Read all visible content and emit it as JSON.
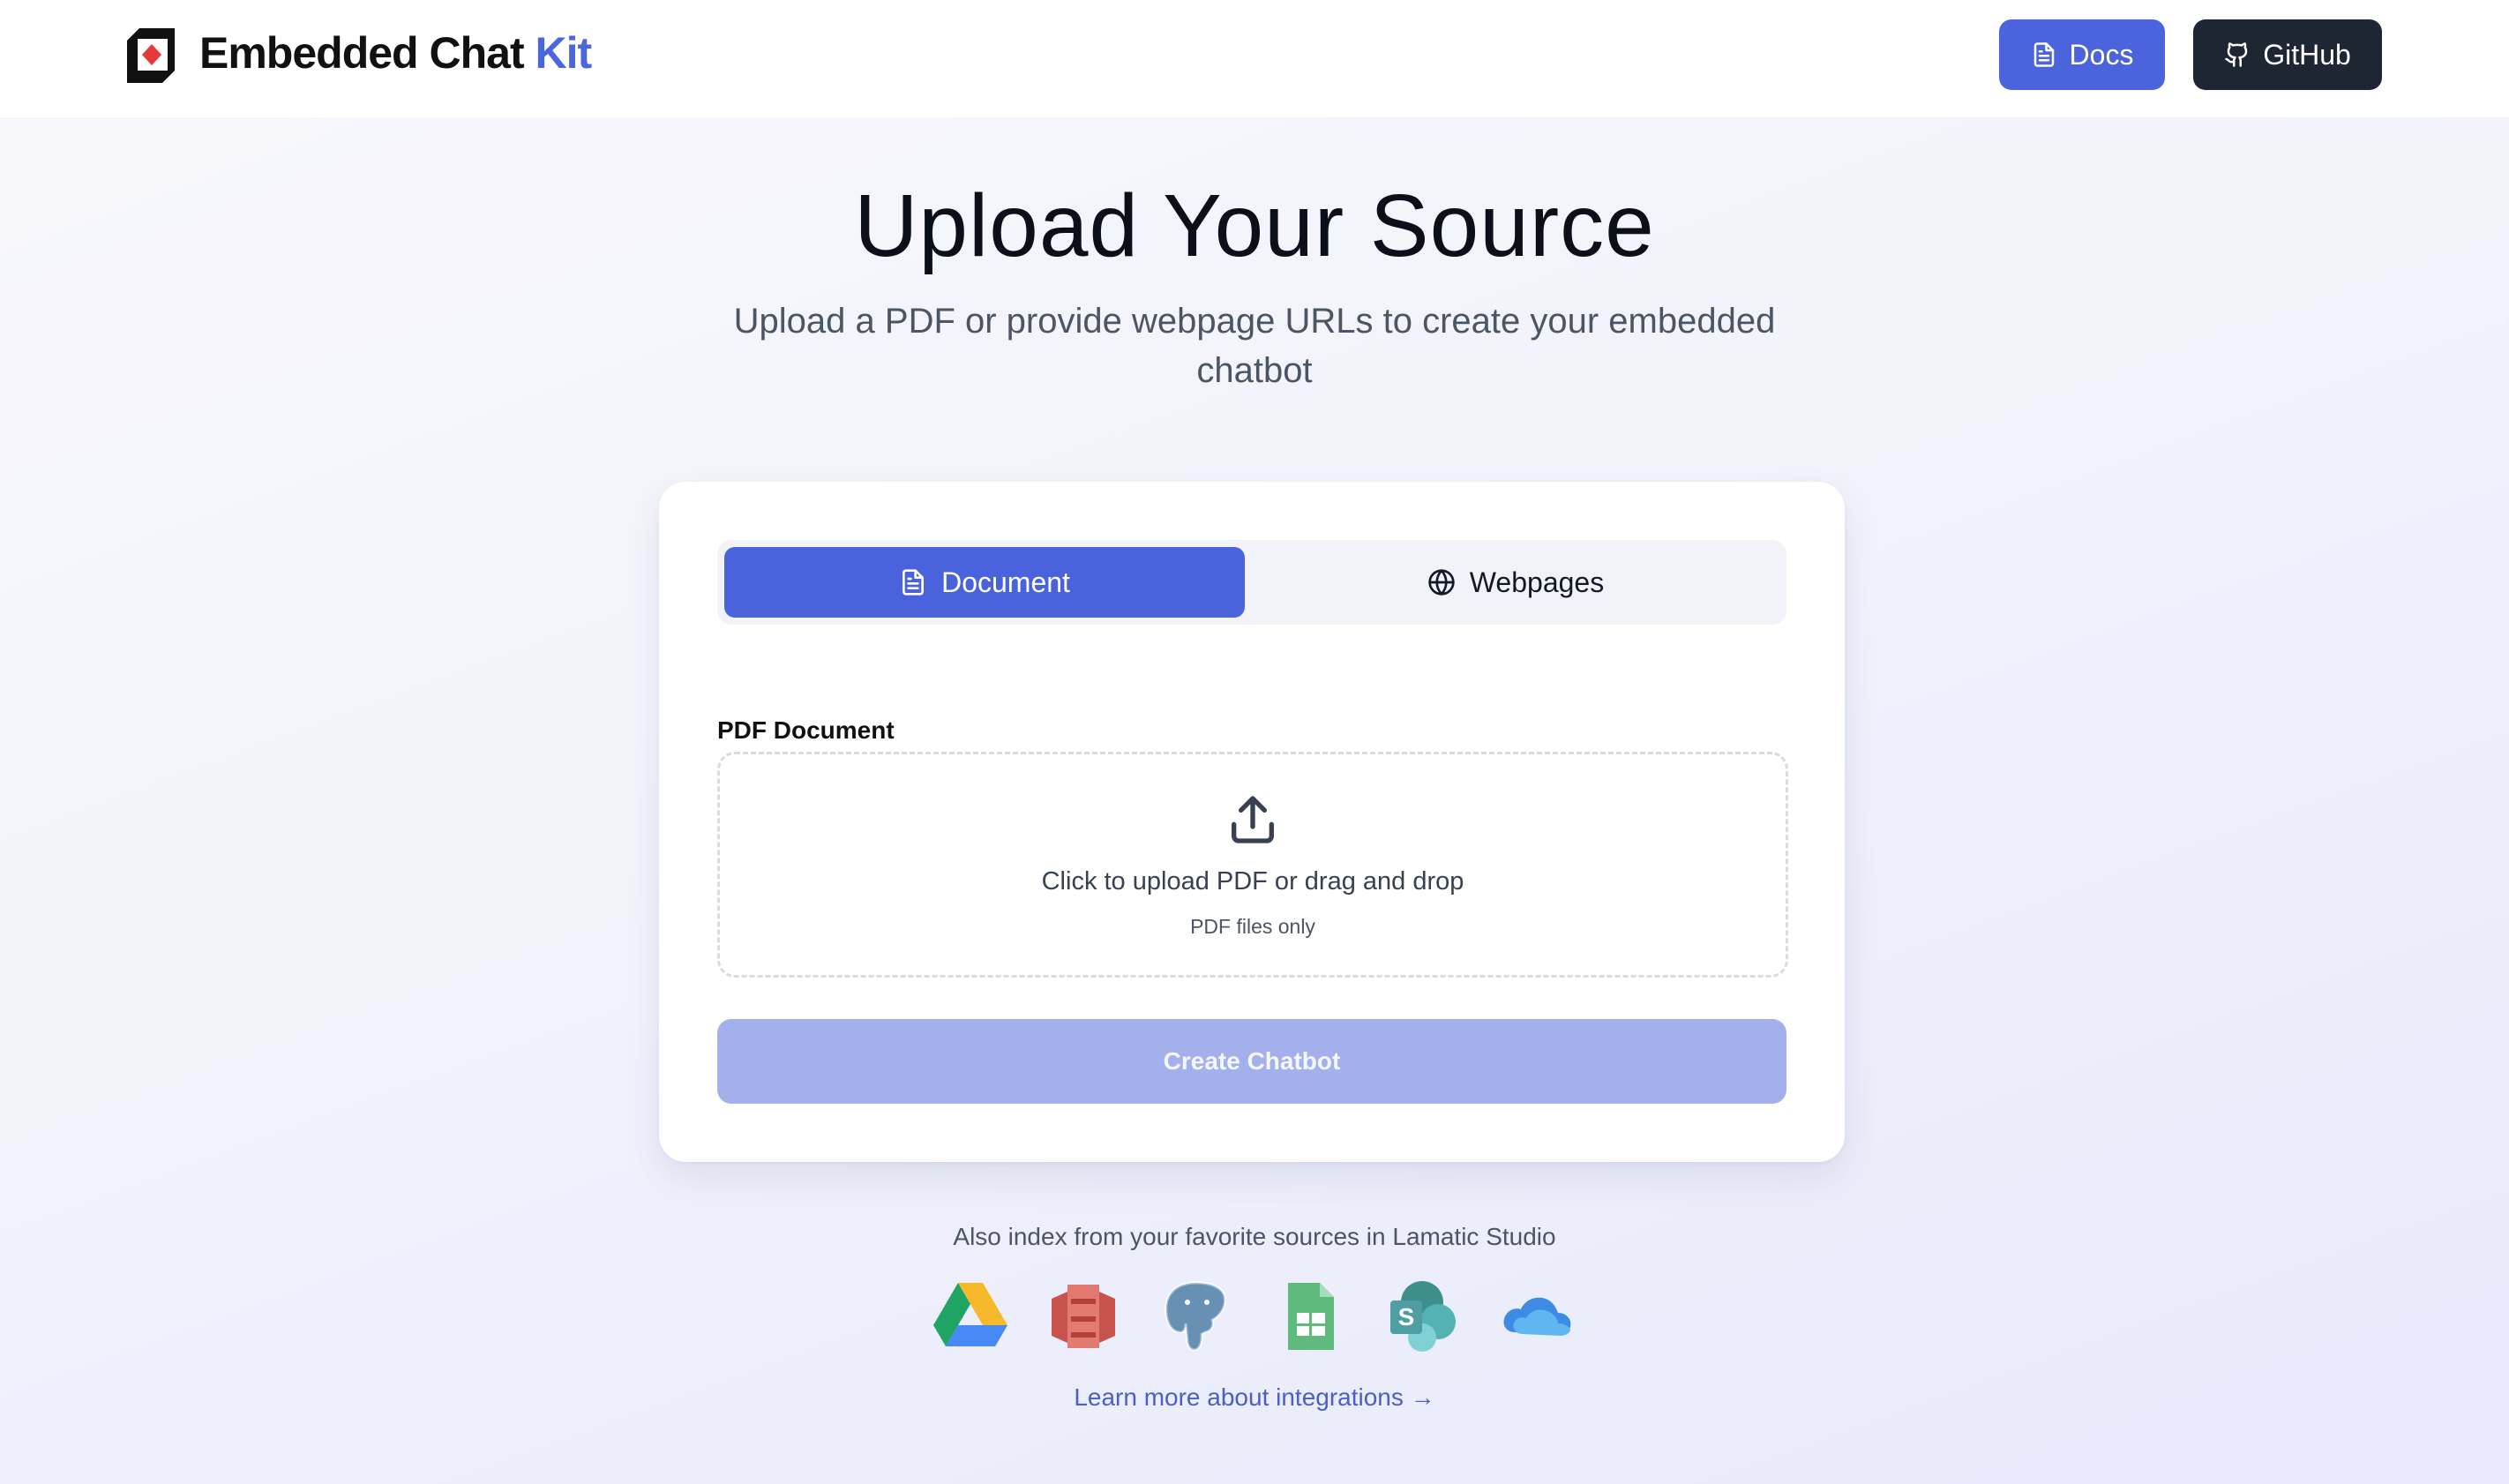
{
  "header": {
    "brand_main": "Embedded Chat ",
    "brand_accent": "Kit",
    "docs_label": "Docs",
    "github_label": "GitHub"
  },
  "hero": {
    "title": "Upload Your Source",
    "subtitle": "Upload a PDF or provide webpage URLs to create your embedded chatbot"
  },
  "form": {
    "tabs": [
      {
        "label": "Document",
        "icon": "file-text-icon",
        "active": true
      },
      {
        "label": "Webpages",
        "icon": "globe-icon",
        "active": false
      }
    ],
    "field_label": "PDF Document",
    "dropzone_text": "Click to upload PDF or drag and drop",
    "dropzone_hint": "PDF files only",
    "submit_label": "Create Chatbot"
  },
  "integrations": {
    "intro": "Also index from your favorite sources in Lamatic Studio",
    "items": [
      "google-drive-icon",
      "aws-s3-icon",
      "postgresql-icon",
      "google-sheets-icon",
      "sharepoint-icon",
      "onedrive-icon"
    ],
    "link_label": "Learn more about integrations →"
  },
  "colors": {
    "accent": "#4a63dc",
    "dark": "#1e2533",
    "disabled_button": "#a4b0ec"
  }
}
